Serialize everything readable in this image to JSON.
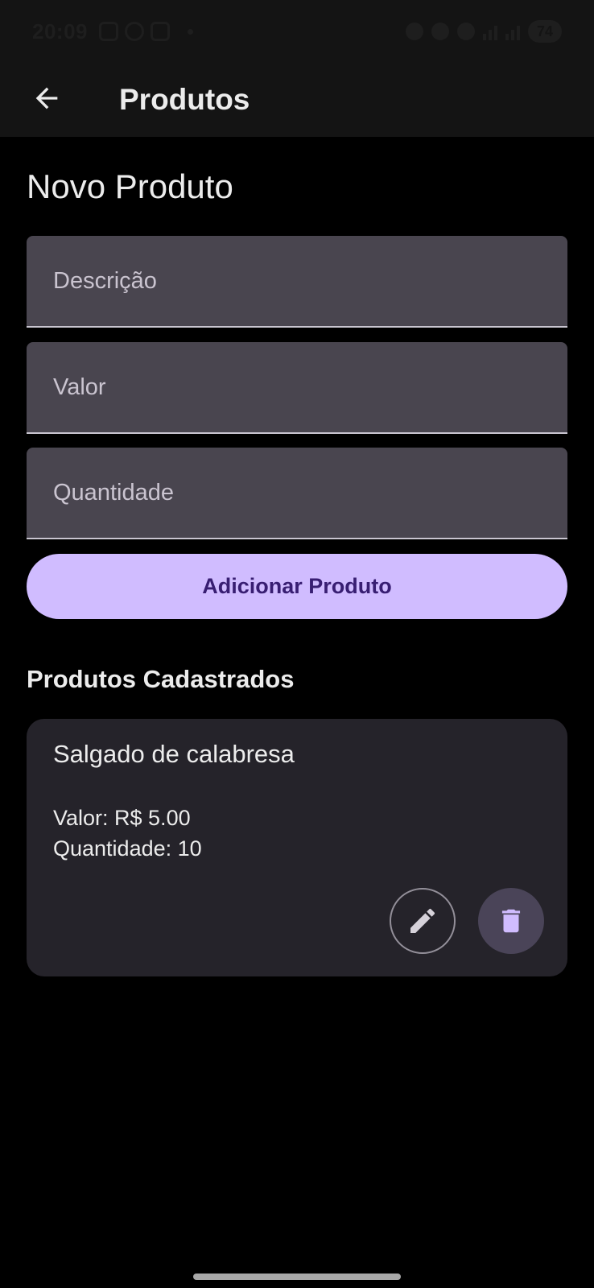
{
  "status_bar": {
    "time": "20:09",
    "battery": "74"
  },
  "app_bar": {
    "title": "Produtos",
    "back_icon": "arrow-back-icon"
  },
  "form": {
    "heading": "Novo Produto",
    "fields": [
      {
        "placeholder": "Descrição",
        "value": ""
      },
      {
        "placeholder": "Valor",
        "value": ""
      },
      {
        "placeholder": "Quantidade",
        "value": ""
      }
    ],
    "submit_label": "Adicionar Produto"
  },
  "list": {
    "heading": "Produtos Cadastrados",
    "items": [
      {
        "name": "Salgado de calabresa",
        "price": "Valor: R$ 5.00",
        "quantity": "Quantidade: 10",
        "edit_icon": "pencil-icon",
        "delete_icon": "trash-icon"
      }
    ]
  },
  "colors": {
    "background": "#000000",
    "app_bar": "#141414",
    "field": "#49454f",
    "primary": "#d0bcff",
    "on_primary": "#381e72",
    "card": "#25232a",
    "delete_button": "#4a4458"
  }
}
